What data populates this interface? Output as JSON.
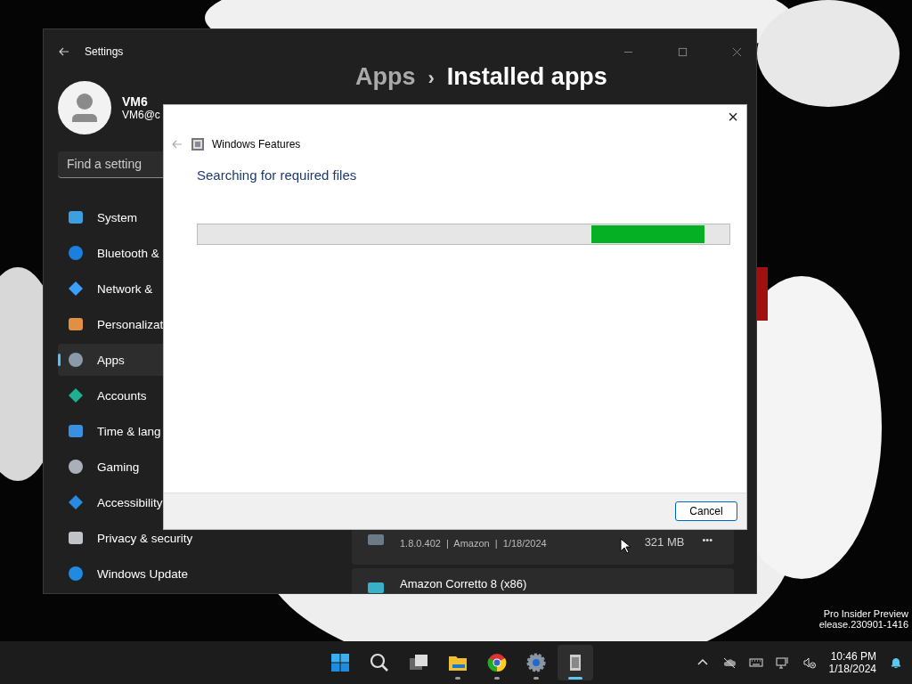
{
  "settings_window": {
    "title": "Settings",
    "user": {
      "name": "VM6",
      "email": "VM6@c"
    },
    "search": {
      "placeholder": "Find a setting"
    },
    "nav": [
      {
        "label": "System",
        "selected": false
      },
      {
        "label": "Bluetooth &",
        "selected": false
      },
      {
        "label": "Network &",
        "selected": false
      },
      {
        "label": "Personalizat",
        "selected": false
      },
      {
        "label": "Apps",
        "selected": true
      },
      {
        "label": "Accounts",
        "selected": false
      },
      {
        "label": "Time & lang",
        "selected": false
      },
      {
        "label": "Gaming",
        "selected": false
      },
      {
        "label": "Accessibility",
        "selected": false
      },
      {
        "label": "Privacy & security",
        "selected": false
      },
      {
        "label": "Windows Update",
        "selected": false
      }
    ],
    "breadcrumb": {
      "parent": "Apps",
      "separator": "›",
      "current": "Installed apps"
    },
    "apps": [
      {
        "details": "1.8.0.402  |  Amazon  |  1/18/2024",
        "size": "321 MB",
        "more": "•••"
      },
      {
        "name": "Amazon Corretto 8 (x86)"
      }
    ]
  },
  "dialog": {
    "title": "Windows Features",
    "heading": "Searching for required files",
    "progress": {
      "indeterminate": true
    },
    "close": "×",
    "buttons": [
      "Cancel"
    ]
  },
  "watermark": [
    "Pro Insider Preview",
    "elease.230901-1416"
  ],
  "taskbar": {
    "apps": [
      {
        "kind": "start",
        "running": false,
        "selected": false
      },
      {
        "kind": "search",
        "running": false,
        "selected": false
      },
      {
        "kind": "taskview",
        "running": false,
        "selected": false
      },
      {
        "kind": "explorer",
        "running": true,
        "selected": false
      },
      {
        "kind": "chrome",
        "running": true,
        "selected": false
      },
      {
        "kind": "settings",
        "running": true,
        "selected": false
      },
      {
        "kind": "features",
        "running": true,
        "selected": true
      }
    ],
    "time": "10:46 PM",
    "date": "1/18/2024"
  }
}
